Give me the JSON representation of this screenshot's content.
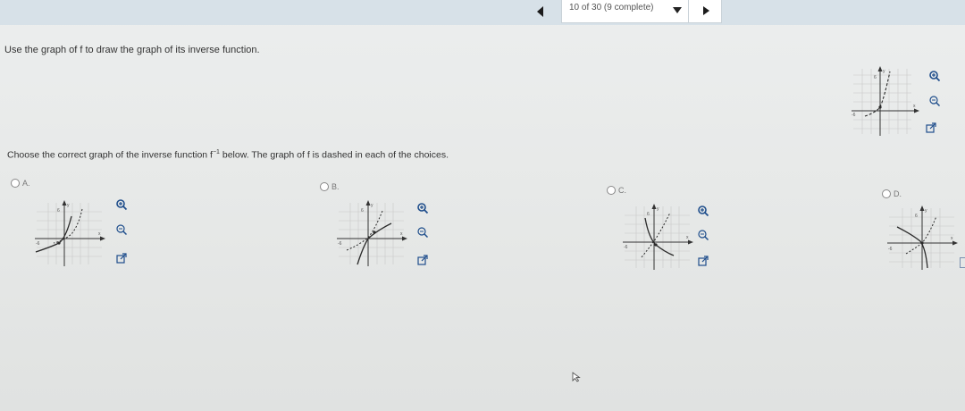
{
  "nav": {
    "progress": "10 of 30 (9 complete)"
  },
  "question": {
    "prompt": "Use the graph of f to draw the graph of its inverse function.",
    "instruction_before": "Choose the correct graph of the inverse function f",
    "instruction_sup": "−1",
    "instruction_after": " below. The graph of f is dashed in each of the choices."
  },
  "axis_labels": {
    "y": "y",
    "x": "x",
    "pos": "6",
    "neg": "-6"
  },
  "choices": [
    {
      "id": "A",
      "label": "A.",
      "selected": false
    },
    {
      "id": "B",
      "label": "B.",
      "selected": false
    },
    {
      "id": "C",
      "label": "C.",
      "selected": false
    },
    {
      "id": "D",
      "label": "D.",
      "selected": false
    }
  ],
  "icons": {
    "zoom_in": "zoom-in-icon",
    "zoom_out": "zoom-out-icon",
    "popout": "popout-icon",
    "prev": "left-arrow-icon",
    "next": "right-arrow-icon",
    "dropdown": "caret-down-icon"
  },
  "colors": {
    "graph_line": "#2a2a2a",
    "accent_blue": "#1f4e8c",
    "topbar": "#d7e1e8"
  }
}
